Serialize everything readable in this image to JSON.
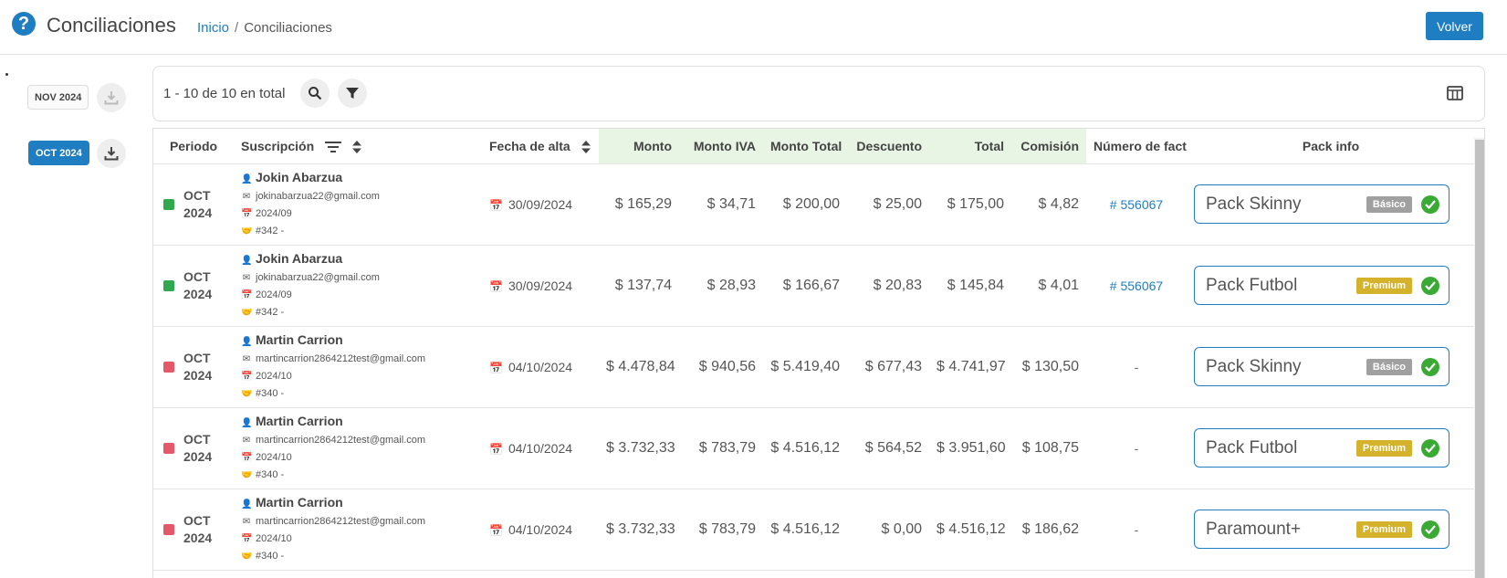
{
  "header": {
    "title": "Conciliaciones",
    "breadcrumb_home": "Inicio",
    "breadcrumb_sep": "/",
    "breadcrumb_current": "Conciliaciones",
    "back_label": "Volver"
  },
  "periods": [
    {
      "label": "NOV 2024",
      "active": false
    },
    {
      "label": "OCT 2024",
      "active": true
    }
  ],
  "toolbar": {
    "total_text": "1 - 10 de 10 en total"
  },
  "table": {
    "columns": {
      "periodo": "Periodo",
      "suscripcion": "Suscripción",
      "fecha_alta": "Fecha de alta",
      "monto": "Monto",
      "monto_iva": "Monto IVA",
      "monto_total": "Monto Total",
      "descuento": "Descuento",
      "total": "Total",
      "comision": "Comisión",
      "numero_factura": "Número de factura",
      "pack_info": "Pack info"
    },
    "rows": [
      {
        "status_color": "#2fa84f",
        "period_month": "OCT",
        "period_year": "2024",
        "name": "Jokin Abarzua",
        "email": "jokinabarzua22@gmail.com",
        "sub_period": "2024/09",
        "sub_id": "#342 -",
        "fecha": "30/09/2024",
        "monto": "$ 165,29",
        "monto_iva": "$ 34,71",
        "monto_total": "$ 200,00",
        "descuento": "$ 25,00",
        "total": "$ 175,00",
        "comision": "$ 4,82",
        "factura": "# 556067",
        "pack_name": "Pack Skinny",
        "pack_tier": "Básico",
        "pack_tier_color": "#a0a0a0"
      },
      {
        "status_color": "#2fa84f",
        "period_month": "OCT",
        "period_year": "2024",
        "name": "Jokin Abarzua",
        "email": "jokinabarzua22@gmail.com",
        "sub_period": "2024/09",
        "sub_id": "#342 -",
        "fecha": "30/09/2024",
        "monto": "$ 137,74",
        "monto_iva": "$ 28,93",
        "monto_total": "$ 166,67",
        "descuento": "$ 20,83",
        "total": "$ 145,84",
        "comision": "$ 4,01",
        "factura": "# 556067",
        "pack_name": "Pack Futbol",
        "pack_tier": "Premium",
        "pack_tier_color": "#d4b22c"
      },
      {
        "status_color": "#e5586a",
        "period_month": "OCT",
        "period_year": "2024",
        "name": "Martin Carrion",
        "email": "martincarrion2864212test@gmail.com",
        "sub_period": "2024/10",
        "sub_id": "#340 -",
        "fecha": "04/10/2024",
        "monto": "$ 4.478,84",
        "monto_iva": "$ 940,56",
        "monto_total": "$ 5.419,40",
        "descuento": "$ 677,43",
        "total": "$ 4.741,97",
        "comision": "$ 130,50",
        "factura": "-",
        "pack_name": "Pack Skinny",
        "pack_tier": "Básico",
        "pack_tier_color": "#a0a0a0"
      },
      {
        "status_color": "#e5586a",
        "period_month": "OCT",
        "period_year": "2024",
        "name": "Martin Carrion",
        "email": "martincarrion2864212test@gmail.com",
        "sub_period": "2024/10",
        "sub_id": "#340 -",
        "fecha": "04/10/2024",
        "monto": "$ 3.732,33",
        "monto_iva": "$ 783,79",
        "monto_total": "$ 4.516,12",
        "descuento": "$ 564,52",
        "total": "$ 3.951,60",
        "comision": "$ 108,75",
        "factura": "-",
        "pack_name": "Pack Futbol",
        "pack_tier": "Premium",
        "pack_tier_color": "#d4b22c"
      },
      {
        "status_color": "#e5586a",
        "period_month": "OCT",
        "period_year": "2024",
        "name": "Martin Carrion",
        "email": "martincarrion2864212test@gmail.com",
        "sub_period": "2024/10",
        "sub_id": "#340 -",
        "fecha": "04/10/2024",
        "monto": "$ 3.732,33",
        "monto_iva": "$ 783,79",
        "monto_total": "$ 4.516,12",
        "descuento": "$ 0,00",
        "total": "$ 4.516,12",
        "comision": "$ 186,62",
        "factura": "-",
        "pack_name": "Paramount+",
        "pack_tier": "Premium",
        "pack_tier_color": "#d4b22c"
      }
    ]
  }
}
